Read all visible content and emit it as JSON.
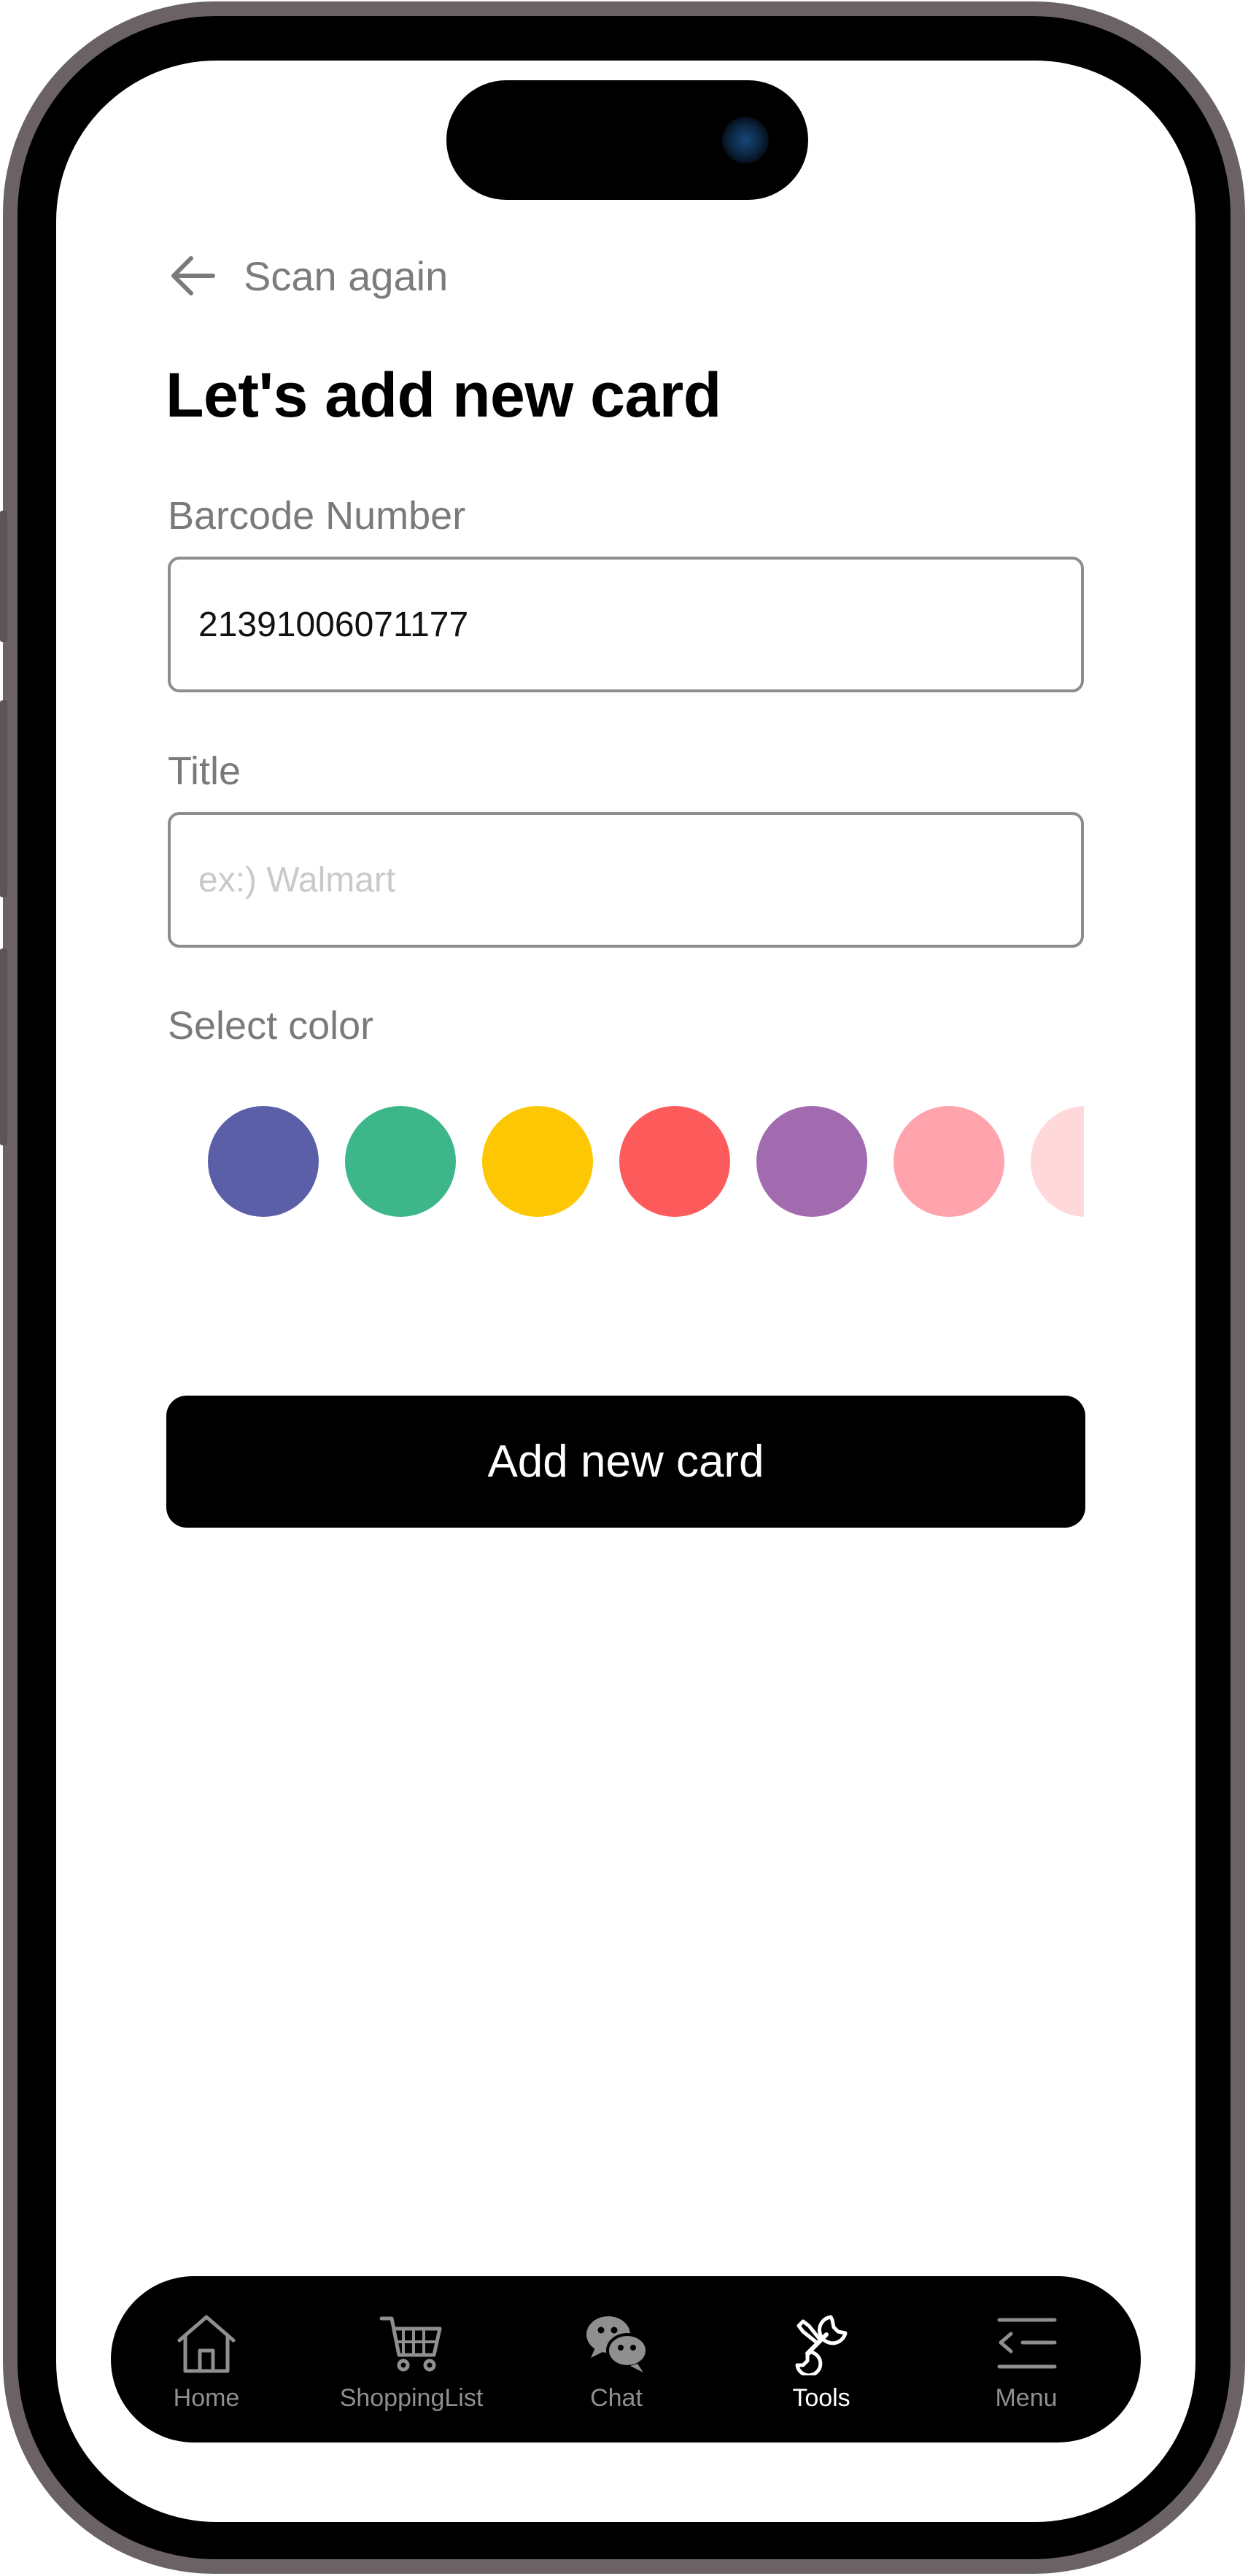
{
  "header": {
    "back_label": "Scan again",
    "title": "Let's add new card"
  },
  "form": {
    "barcode": {
      "label": "Barcode Number",
      "value": "21391006071177"
    },
    "title": {
      "label": "Title",
      "value": "",
      "placeholder": "ex:) Walmart"
    },
    "color": {
      "label": "Select color",
      "swatches": [
        "#5b5fa8",
        "#3db68a",
        "#fdc704",
        "#fd5b5b",
        "#a26bb0",
        "#ffa3ad",
        "#ffd9da"
      ]
    },
    "submit_label": "Add new card"
  },
  "tabbar": {
    "active": "Tools",
    "items": [
      {
        "label": "Home",
        "icon": "home-icon"
      },
      {
        "label": "ShoppingList",
        "icon": "cart-icon"
      },
      {
        "label": "Chat",
        "icon": "chat-icon"
      },
      {
        "label": "Tools",
        "icon": "tools-icon"
      },
      {
        "label": "Menu",
        "icon": "menu-icon"
      }
    ]
  }
}
